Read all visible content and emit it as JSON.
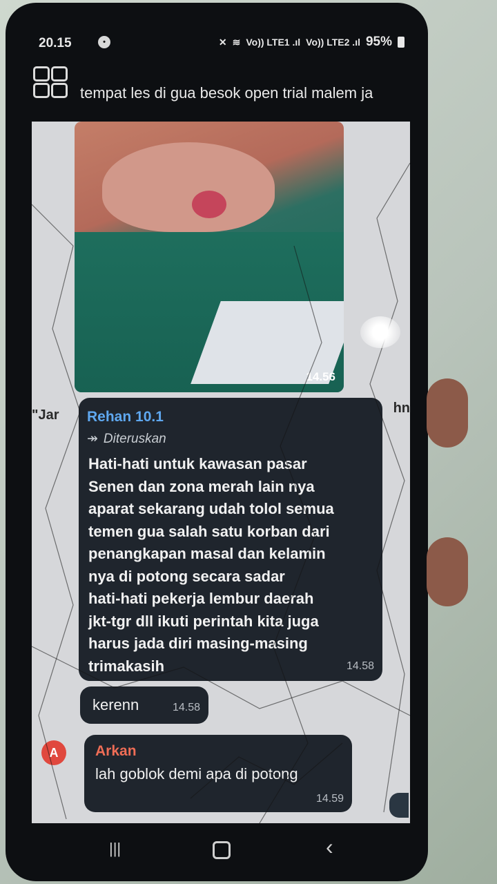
{
  "status_bar": {
    "time": "20.15",
    "signal_1": "Vo)) LTE1 .ıl",
    "signal_2": "Vo)) LTE2 .ıl",
    "battery": "95%"
  },
  "notification": {
    "app_icon": "grid-app-icon",
    "text": "tempat les di gua besok open trial malem ja"
  },
  "chat": {
    "photo": {
      "time": "14.56"
    },
    "partial_left": "\"Jar",
    "partial_right": "hn",
    "forwarded_message": {
      "sender": "Rehan 10.1",
      "forwarded_label": "Diteruskan",
      "lines": [
        "Hati-hati untuk kawasan pasar",
        "Senen dan zona merah lain nya",
        "aparat sekarang udah tolol semua",
        "temen gua salah satu korban dari",
        "penangkapan masal dan kelamin",
        "nya di potong secara sadar",
        "hati-hati pekerja lembur daerah",
        "jkt-tgr dll ikuti perintah kita juga",
        "harus jada diri masing-masing",
        "trimakasih"
      ],
      "time": "14.58"
    },
    "kerenn": {
      "text": "kerenn",
      "time": "14.58"
    },
    "arkan": {
      "avatar_letter": "A",
      "sender": "Arkan",
      "text": "lah goblok demi apa di potong",
      "time": "14.59"
    }
  },
  "nav_bar": {
    "recent_icon": "recent-apps-icon",
    "home_icon": "home-icon",
    "back_icon": "back-icon"
  }
}
